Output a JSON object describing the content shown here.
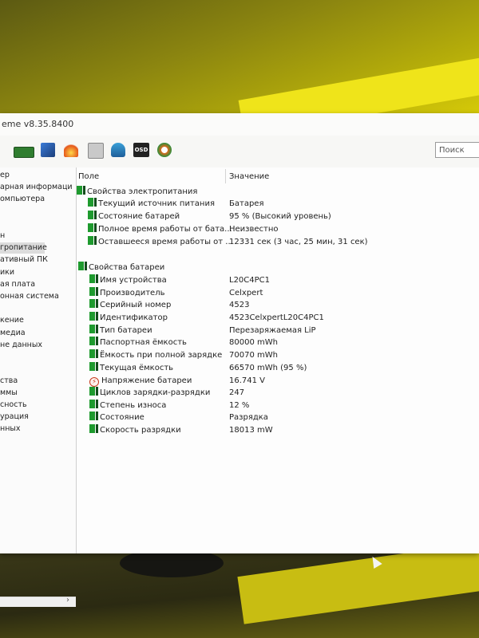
{
  "window": {
    "title": "eme v8.35.8400",
    "search_placeholder": "Поиск"
  },
  "toolbar": {
    "icons": [
      "memory-icon",
      "network-icon",
      "fire-icon",
      "printer-icon",
      "users-icon",
      "osd-icon",
      "gauge-icon"
    ],
    "osd_label": "OSD"
  },
  "sidebar": {
    "items": [
      {
        "label": "ер",
        "selected": false
      },
      {
        "label": "арная информаци",
        "selected": false
      },
      {
        "label": "омпьютера",
        "selected": false
      },
      {
        "label": "н",
        "selected": false
      },
      {
        "label": "гропитание",
        "selected": true
      },
      {
        "label": "ативный ПК",
        "selected": false
      },
      {
        "label": "ики",
        "selected": false
      },
      {
        "label": "ая плата",
        "selected": false
      },
      {
        "label": "онная система",
        "selected": false
      },
      {
        "label": "кение",
        "selected": false
      },
      {
        "label": "медиа",
        "selected": false
      },
      {
        "label": "не данных",
        "selected": false
      },
      {
        "label": "ства",
        "selected": false
      },
      {
        "label": "ммы",
        "selected": false
      },
      {
        "label": "сность",
        "selected": false
      },
      {
        "label": "урация",
        "selected": false
      },
      {
        "label": "нных",
        "selected": false
      }
    ]
  },
  "table": {
    "col_field": "Поле",
    "col_value": "Значение",
    "group1": {
      "title": "Свойства электропитания",
      "rows": [
        {
          "field": "Текущий источник питания",
          "value": "Батарея"
        },
        {
          "field": "Состояние батарей",
          "value": "95 % (Высокий уровень)"
        },
        {
          "field": "Полное время работы от бата...",
          "value": "Неизвестно"
        },
        {
          "field": "Оставшееся время работы от ...",
          "value": "12331 сек (3 час, 25 мин, 31 сек)"
        }
      ]
    },
    "group2": {
      "title": "Свойства батареи",
      "rows": [
        {
          "field": "Имя устройства",
          "value": "L20C4PC1"
        },
        {
          "field": "Производитель",
          "value": "Celxpert"
        },
        {
          "field": "Серийный номер",
          "value": "4523"
        },
        {
          "field": "Идентификатор",
          "value": "4523CelxpertL20C4PC1"
        },
        {
          "field": "Тип батареи",
          "value": "Перезаряжаемая LiP"
        },
        {
          "field": "Паспортная ёмкость",
          "value": "80000 mWh"
        },
        {
          "field": "Ёмкость при полной зарядке",
          "value": "70070 mWh"
        },
        {
          "field": "Текущая ёмкость",
          "value": "66570 mWh  (95 %)"
        },
        {
          "field": "Напряжение батареи",
          "value": "16.741 V"
        },
        {
          "field": "Циклов зарядки-разрядки",
          "value": "247"
        },
        {
          "field": "Степень износа",
          "value": "12 %"
        },
        {
          "field": "Состояние",
          "value": "Разрядка"
        },
        {
          "field": "Скорость разрядки",
          "value": "18013 mW"
        }
      ]
    }
  }
}
